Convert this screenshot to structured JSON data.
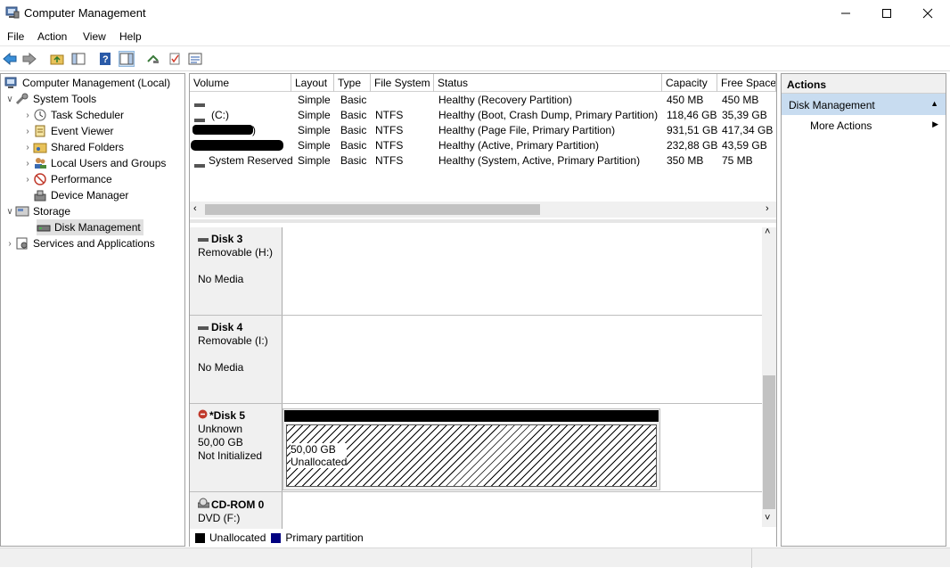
{
  "window": {
    "title": "Computer Management"
  },
  "menu": [
    "File",
    "Action",
    "View",
    "Help"
  ],
  "tree": {
    "root": "Computer Management (Local)",
    "system_tools": "System Tools",
    "items": [
      "Task Scheduler",
      "Event Viewer",
      "Shared Folders",
      "Local Users and Groups",
      "Performance",
      "Device Manager"
    ],
    "storage": "Storage",
    "disk_management": "Disk Management",
    "services": "Services and Applications"
  },
  "volumes": {
    "columns": [
      "Volume",
      "Layout",
      "Type",
      "File System",
      "Status",
      "Capacity",
      "Free Space"
    ],
    "rows": [
      {
        "volume": "",
        "layout": "Simple",
        "type": "Basic",
        "fs": "",
        "status": "Healthy (Recovery Partition)",
        "capacity": "450 MB",
        "free": "450 MB"
      },
      {
        "volume": "(C:)",
        "layout": "Simple",
        "type": "Basic",
        "fs": "NTFS",
        "status": "Healthy (Boot, Crash Dump, Primary Partition)",
        "capacity": "118,46 GB",
        "free": "35,39 GB"
      },
      {
        "volume": ")",
        "layout": "Simple",
        "type": "Basic",
        "fs": "NTFS",
        "status": "Healthy (Page File, Primary Partition)",
        "capacity": "931,51 GB",
        "free": "417,34 GB"
      },
      {
        "volume": "",
        "layout": "Simple",
        "type": "Basic",
        "fs": "NTFS",
        "status": "Healthy (Active, Primary Partition)",
        "capacity": "232,88 GB",
        "free": "43,59 GB"
      },
      {
        "volume": "System Reserved",
        "layout": "Simple",
        "type": "Basic",
        "fs": "NTFS",
        "status": "Healthy (System, Active, Primary Partition)",
        "capacity": "350 MB",
        "free": "75 MB"
      }
    ]
  },
  "disks": [
    {
      "name": "Disk 3",
      "line1": "Removable (H:)",
      "line2": "",
      "line3": "No Media"
    },
    {
      "name": "Disk 4",
      "line1": "Removable (I:)",
      "line2": "",
      "line3": "No Media"
    },
    {
      "name": "*Disk 5",
      "line1": "Unknown",
      "line2": "50,00 GB",
      "line3": "Not Initialized",
      "partition_size": "50,00 GB",
      "partition_label": "Unallocated"
    },
    {
      "name": "CD-ROM 0",
      "line1": "DVD (F:)"
    }
  ],
  "legend": {
    "unallocated": "Unallocated",
    "primary": "Primary partition",
    "unallocated_color": "#000000",
    "primary_color": "#000080"
  },
  "actions": {
    "header": "Actions",
    "section": "Disk Management",
    "more": "More Actions"
  }
}
